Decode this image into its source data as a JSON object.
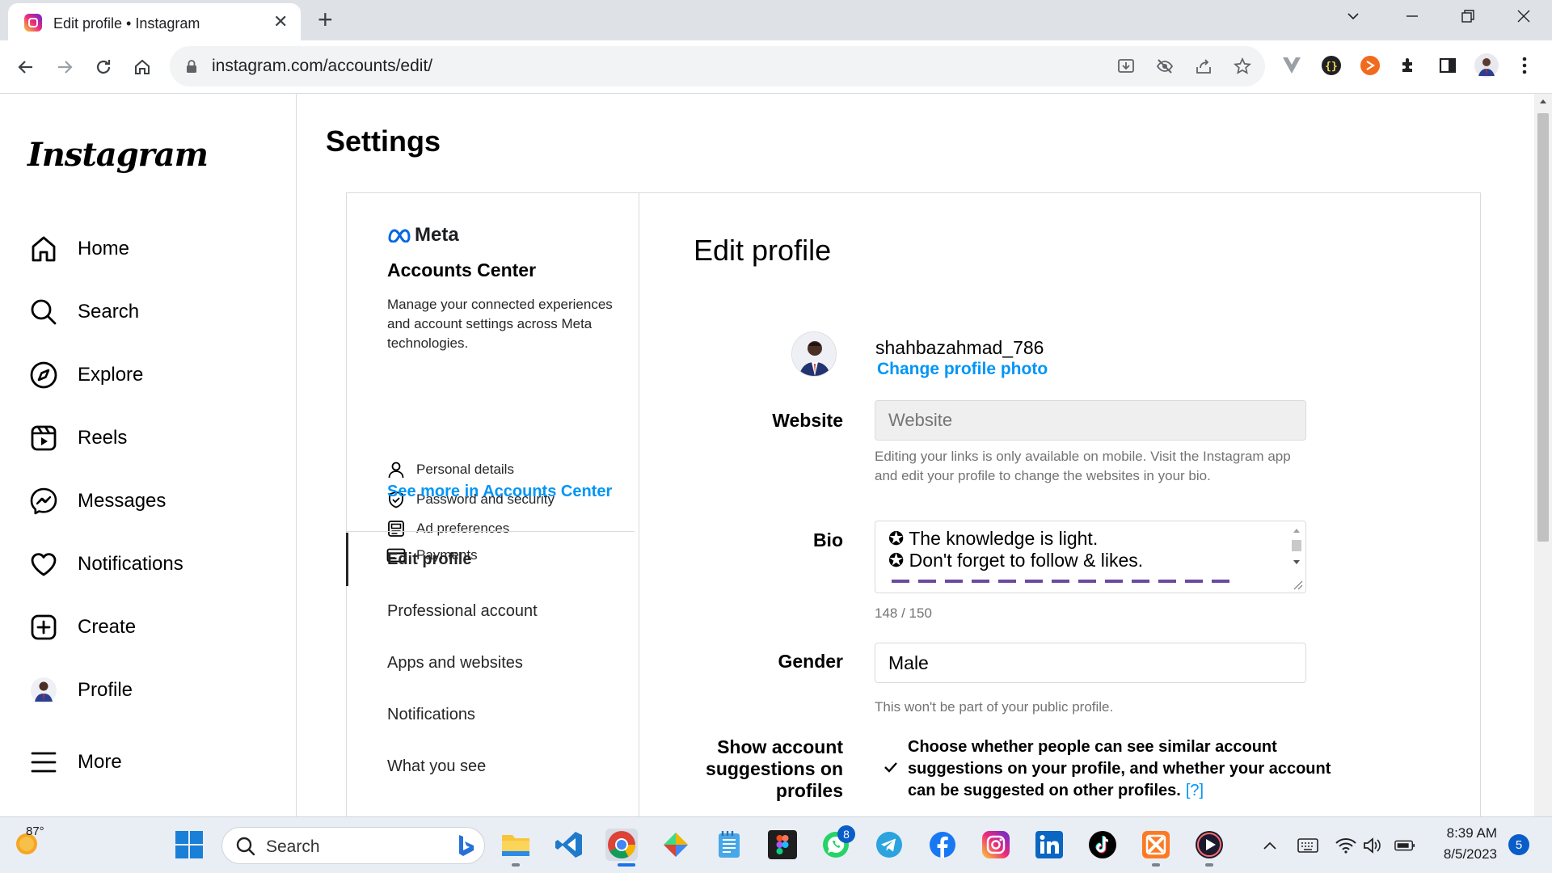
{
  "browser": {
    "tab_title": "Edit profile • Instagram",
    "tab_close": "✕",
    "new_tab": "+",
    "url": "instagram.com/accounts/edit/"
  },
  "instagram": {
    "logo": "Instagram",
    "nav": [
      {
        "label": "Home",
        "icon": "home-icon"
      },
      {
        "label": "Search",
        "icon": "search-icon"
      },
      {
        "label": "Explore",
        "icon": "compass-icon"
      },
      {
        "label": "Reels",
        "icon": "reels-icon"
      },
      {
        "label": "Messages",
        "icon": "messenger-icon"
      },
      {
        "label": "Notifications",
        "icon": "heart-icon"
      },
      {
        "label": "Create",
        "icon": "plus-square-icon"
      },
      {
        "label": "Profile",
        "icon": "avatar"
      },
      {
        "label": "More",
        "icon": "hamburger-icon"
      }
    ]
  },
  "settings": {
    "title": "Settings",
    "accounts_center": {
      "brand": "Meta",
      "title": "Accounts Center",
      "description": "Manage your connected experiences and account settings across Meta technologies.",
      "items": [
        {
          "label": "Personal details",
          "icon": "person-icon"
        },
        {
          "label": "Password and security",
          "icon": "shield-icon"
        },
        {
          "label": "Ad preferences",
          "icon": "ad-icon"
        },
        {
          "label": "Payments",
          "icon": "card-icon"
        }
      ],
      "see_more": "See more in Accounts Center"
    },
    "menu": [
      "Edit profile",
      "Professional account",
      "Apps and websites",
      "Notifications",
      "What you see"
    ],
    "active_menu": "Edit profile"
  },
  "edit_profile": {
    "title": "Edit profile",
    "username": "shahbazahmad_786",
    "change_photo": "Change profile photo",
    "website": {
      "label": "Website",
      "placeholder": "Website",
      "help": "Editing your links is only available on mobile. Visit the Instagram app and edit your profile to change the websites in your bio."
    },
    "bio": {
      "label": "Bio",
      "lines": [
        "✪ The knowledge is light.",
        "✪ Don't forget to follow & likes."
      ],
      "count": "148 / 150"
    },
    "gender": {
      "label": "Gender",
      "value": "Male",
      "help": "This won't be part of your public profile."
    },
    "suggestions": {
      "label": "Show account suggestions on profiles",
      "text": "Choose whether people can see similar account suggestions on your profile, and whether your account can be suggested on other profiles.",
      "help_link": "[?]",
      "checked": true
    }
  },
  "taskbar": {
    "weather": "87°",
    "search": "Search",
    "whatsapp_badge": "8",
    "time": "8:39 AM",
    "date": "8/5/2023",
    "notifications": "5"
  },
  "colors": {
    "link": "#0095f6",
    "border": "#dbdbdb",
    "chrome_bg": "#dee1e6"
  }
}
